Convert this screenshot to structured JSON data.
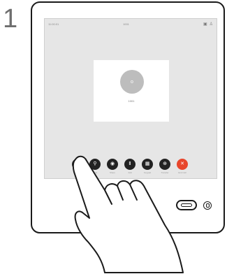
{
  "step": {
    "number": "1"
  },
  "screen": {
    "status_left": "11:00:01",
    "status_center": "1001",
    "status_right_glyph_1": "▣",
    "status_right_glyph_2": "♙",
    "call_card": {
      "avatar_text": "o",
      "label": "1001"
    }
  },
  "controls": [
    {
      "icon": "share-icon",
      "label": "Hold",
      "glyph": "↻"
    },
    {
      "icon": "mic-icon",
      "label": "Mute",
      "glyph": "⚲"
    },
    {
      "icon": "volume-icon",
      "label": "Share",
      "glyph": "◉"
    },
    {
      "icon": "pause-icon",
      "label": "Add",
      "glyph": "Ⅱ"
    },
    {
      "icon": "keypad-icon",
      "label": "Keypad",
      "glyph": "▦"
    },
    {
      "icon": "transfer-icon",
      "label": "Transfer",
      "glyph": "⊕"
    },
    {
      "icon": "end-call-icon",
      "label": "End Call",
      "glyph": "✕"
    }
  ],
  "colors": {
    "end_call": "#e8462c",
    "button": "#222222",
    "screen_bg": "#e6e6e6"
  }
}
